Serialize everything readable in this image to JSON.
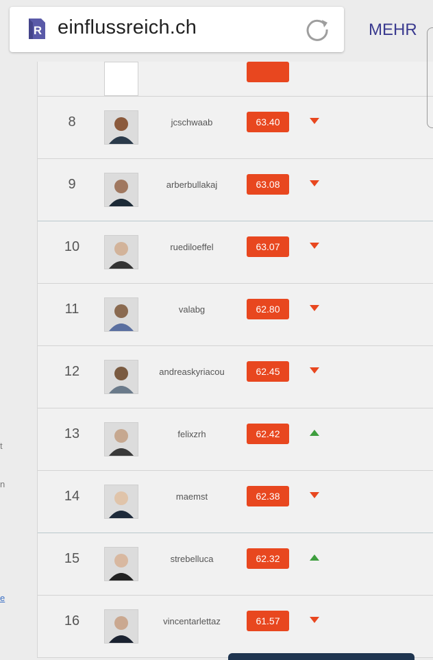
{
  "browser": {
    "site_icon": "R",
    "url": "einflussreich.ch",
    "reload_icon": "reload-icon",
    "menu_label": "MEHR"
  },
  "sidebar": {
    "fragments": [
      "t",
      "n",
      "e"
    ]
  },
  "colors": {
    "score_badge": "#e8471f",
    "trend_down": "#e8471f",
    "trend_up": "#3e9e3e",
    "menu": "#3a3a8f"
  },
  "rows": [
    {
      "rank": "8",
      "username": "jcschwaab",
      "score": "63.40",
      "trend": "down"
    },
    {
      "rank": "9",
      "username": "arberbullakaj",
      "score": "63.08",
      "trend": "down"
    },
    {
      "rank": "10",
      "username": "ruediloeffel",
      "score": "63.07",
      "trend": "down"
    },
    {
      "rank": "11",
      "username": "valabg",
      "score": "62.80",
      "trend": "down"
    },
    {
      "rank": "12",
      "username": "andreaskyriacou",
      "score": "62.45",
      "trend": "down"
    },
    {
      "rank": "13",
      "username": "felixzrh",
      "score": "62.42",
      "trend": "up"
    },
    {
      "rank": "14",
      "username": "maemst",
      "score": "62.38",
      "trend": "down"
    },
    {
      "rank": "15",
      "username": "strebelluca",
      "score": "62.32",
      "trend": "up"
    },
    {
      "rank": "16",
      "username": "vincentarlettaz",
      "score": "61.57",
      "trend": "down"
    }
  ]
}
